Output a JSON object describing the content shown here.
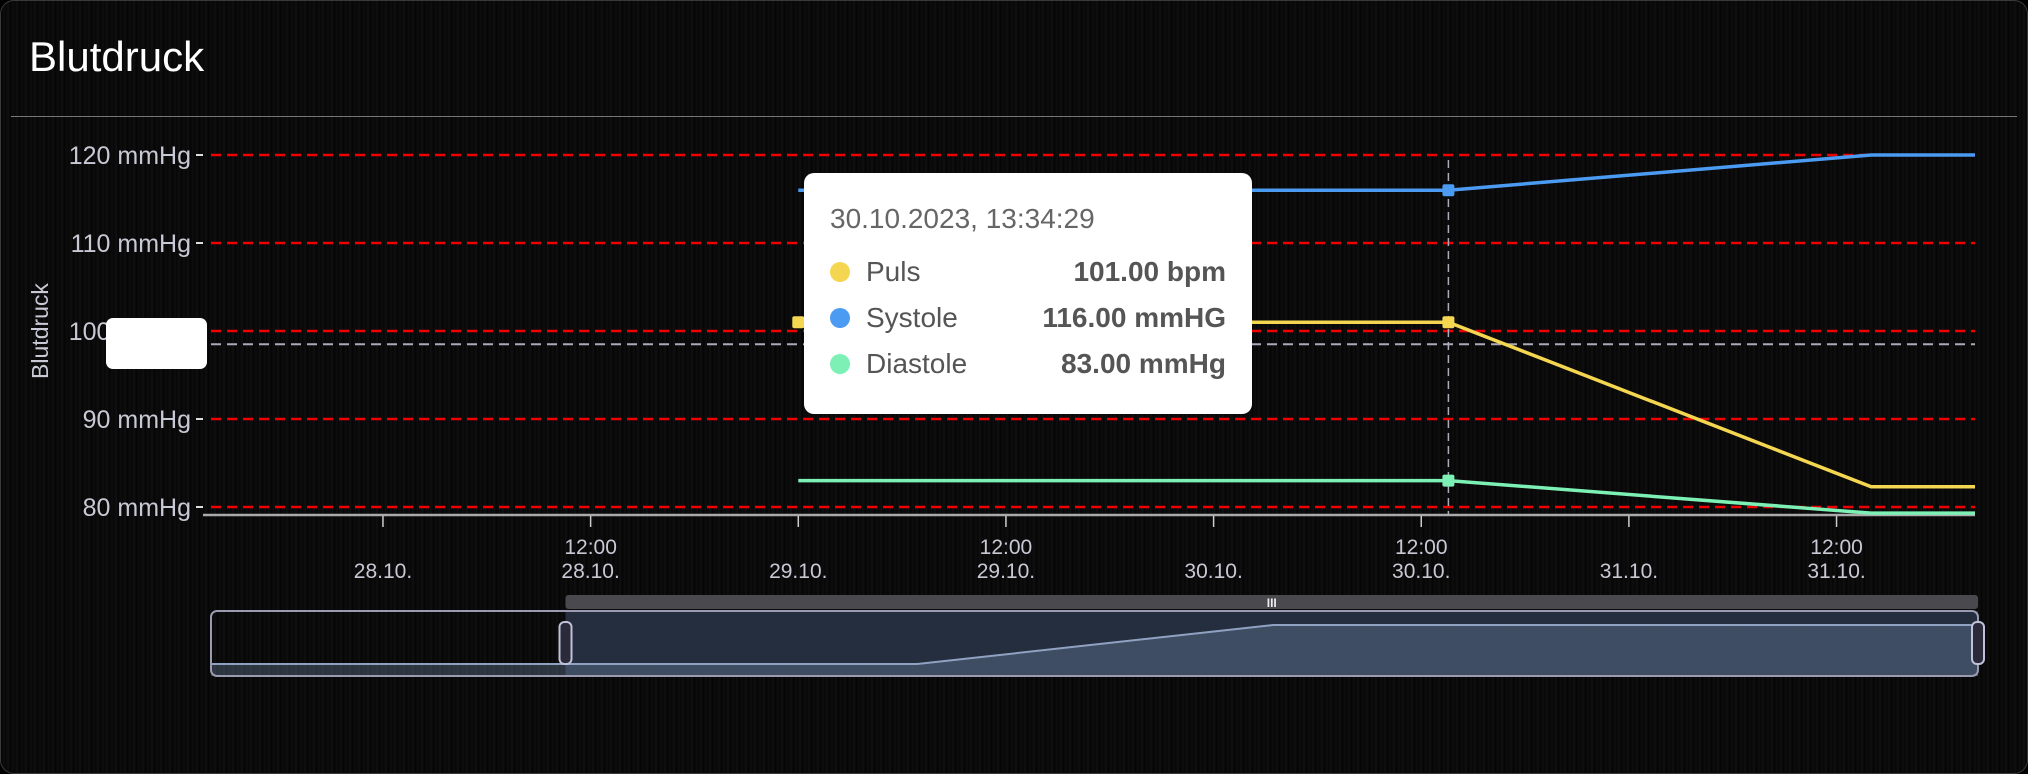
{
  "card": {
    "title": "Blutdruck"
  },
  "chart_data": {
    "type": "line",
    "title": "Blutdruck",
    "ylabel": "Blutdruck",
    "xlabel": "",
    "ylim": [
      80,
      120
    ],
    "y_ticks": [
      "120 mmHg",
      "110 mmHg",
      "100 mmHg",
      "90 mmHg",
      "80 mmHg"
    ],
    "y_tick_values": [
      120,
      110,
      100,
      90,
      80
    ],
    "grid": "red dashed horizontal",
    "x_unit": "hours since 28.10.2023 00:00",
    "xlim": [
      -10.4,
      92
    ],
    "x_ticks": [
      {
        "x": 0,
        "time": "",
        "date": "28.10."
      },
      {
        "x": 12,
        "time": "12:00",
        "date": "28.10."
      },
      {
        "x": 24,
        "time": "",
        "date": "29.10."
      },
      {
        "x": 36,
        "time": "12:00",
        "date": "29.10."
      },
      {
        "x": 48,
        "time": "",
        "date": "30.10."
      },
      {
        "x": 60,
        "time": "12:00",
        "date": "30.10."
      },
      {
        "x": 72,
        "time": "",
        "date": "31.10."
      },
      {
        "x": 84,
        "time": "12:00",
        "date": "31.10."
      }
    ],
    "series": [
      {
        "name": "Puls",
        "unit": "bpm",
        "color": "#f5d650",
        "x": [
          24,
          61.57,
          86,
          92
        ],
        "values": [
          101,
          101,
          82.3,
          82.3
        ]
      },
      {
        "name": "Systole",
        "unit": "mmHG",
        "color": "#4c9bf2",
        "x": [
          24,
          61.57,
          86,
          92
        ],
        "values": [
          116,
          116,
          120,
          120
        ]
      },
      {
        "name": "Diastole",
        "unit": "mmHg",
        "color": "#7cf0b5",
        "x": [
          24,
          61.57,
          86,
          92
        ],
        "values": [
          83,
          83,
          79.3,
          79.3
        ]
      }
    ],
    "crosshair": {
      "x": 61.57,
      "y": 98.5
    },
    "navigator": {
      "range": [
        -36.1,
        92
      ],
      "selected": [
        -10.4,
        92
      ],
      "x": [
        -36.1,
        15.1,
        40.9,
        92
      ],
      "values": [
        116,
        116,
        120,
        120
      ]
    },
    "tooltip": {
      "time": "30.10.2023, 13:34:29",
      "rows": [
        {
          "name": "Puls",
          "value": "101.00 bpm",
          "color": "#f5d650"
        },
        {
          "name": "Systole",
          "value": "116.00 mmHG",
          "color": "#4c9bf2"
        },
        {
          "name": "Diastole",
          "value": "83.00 mmHg",
          "color": "#7cf0b5"
        }
      ]
    },
    "scrollbar_grip": "III"
  }
}
